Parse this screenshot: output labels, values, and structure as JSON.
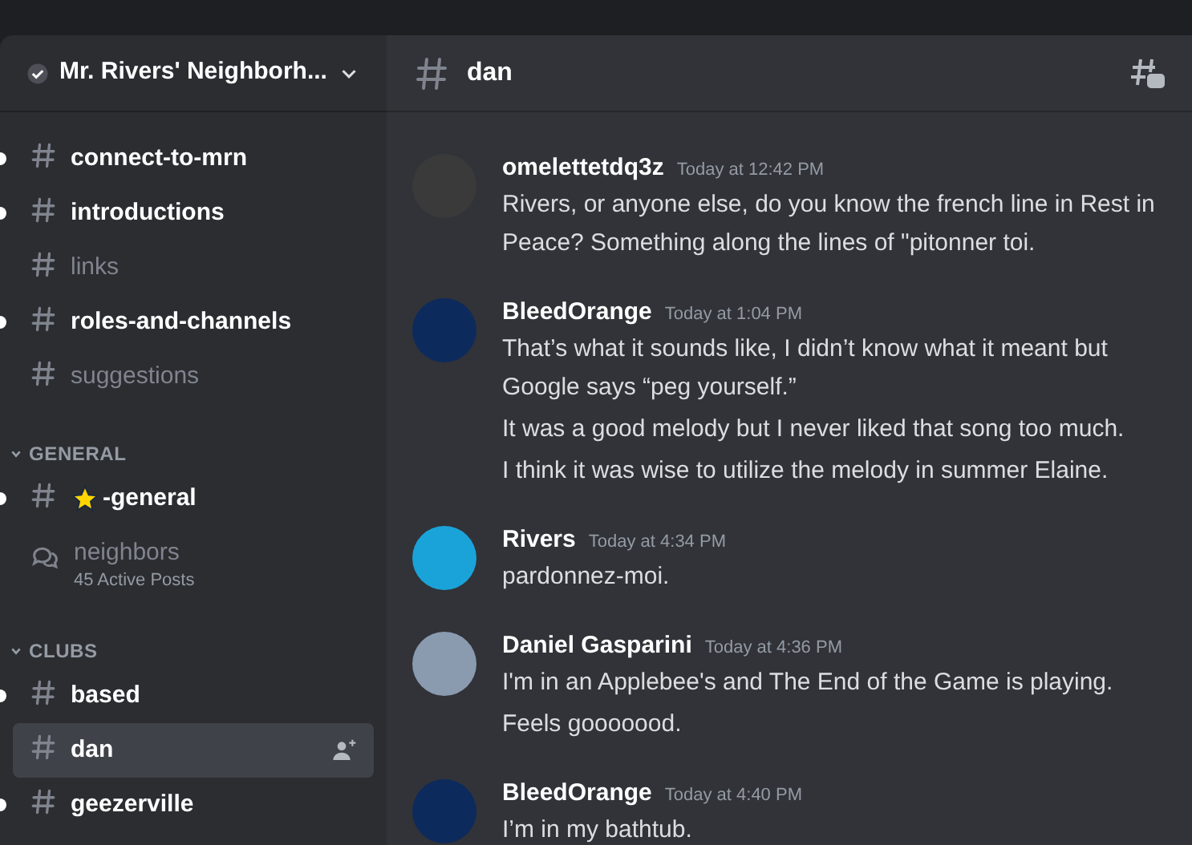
{
  "server": {
    "name": "Mr. Rivers' Neighborh..."
  },
  "sidebar": {
    "sections": [
      {
        "channels": [
          {
            "kind": "text",
            "name": "connect-to-mrn",
            "unread": true,
            "selected": false
          },
          {
            "kind": "text",
            "name": "introductions",
            "unread": true,
            "selected": false
          },
          {
            "kind": "text",
            "name": "links",
            "unread": false,
            "selected": false
          },
          {
            "kind": "text",
            "name": "roles-and-channels",
            "unread": true,
            "selected": false
          },
          {
            "kind": "text",
            "name": "suggestions",
            "unread": false,
            "selected": false
          }
        ]
      },
      {
        "title": "GENERAL",
        "channels": [
          {
            "kind": "star",
            "name": "-general",
            "unread": true,
            "selected": false
          },
          {
            "kind": "forum",
            "name": "neighbors",
            "subtitle": "45 Active Posts",
            "unread": false,
            "selected": false
          }
        ]
      },
      {
        "title": "CLUBS",
        "channels": [
          {
            "kind": "text",
            "name": "based",
            "unread": true,
            "selected": false
          },
          {
            "kind": "text",
            "name": "dan",
            "unread": false,
            "selected": true
          },
          {
            "kind": "text",
            "name": "geezerville",
            "unread": true,
            "selected": false
          }
        ]
      }
    ]
  },
  "channel": {
    "name": "dan"
  },
  "messages": [
    {
      "author": "omelettetdq3z",
      "time": "Today at 12:42 PM",
      "color": "#3a3a3a",
      "lines": [
        "Rivers, or anyone else, do you know the french line in Rest in Peace? Something along the lines of \"pitonner toi."
      ]
    },
    {
      "author": "BleedOrange",
      "time": "Today at 1:04 PM",
      "color": "#0d2a5c",
      "lines": [
        "That’s what it sounds like, I didn’t know what it meant but Google says “peg yourself.”",
        "It was a good melody but I never liked that song too much.",
        "I think it was wise to utilize the melody in summer Elaine."
      ]
    },
    {
      "author": "Rivers",
      "time": "Today at 4:34 PM",
      "color": "#1aa3d9",
      "lines": [
        "pardonnez-moi."
      ]
    },
    {
      "author": "Daniel Gasparini",
      "time": "Today at 4:36 PM",
      "color": "#8a9bb0",
      "lines": [
        "I'm in an Applebee's and The End of the Game is playing.",
        "Feels gooooood."
      ]
    },
    {
      "author": "BleedOrange",
      "time": "Today at 4:40 PM",
      "color": "#0d2a5c",
      "lines": [
        "I’m in my bathtub."
      ]
    }
  ]
}
